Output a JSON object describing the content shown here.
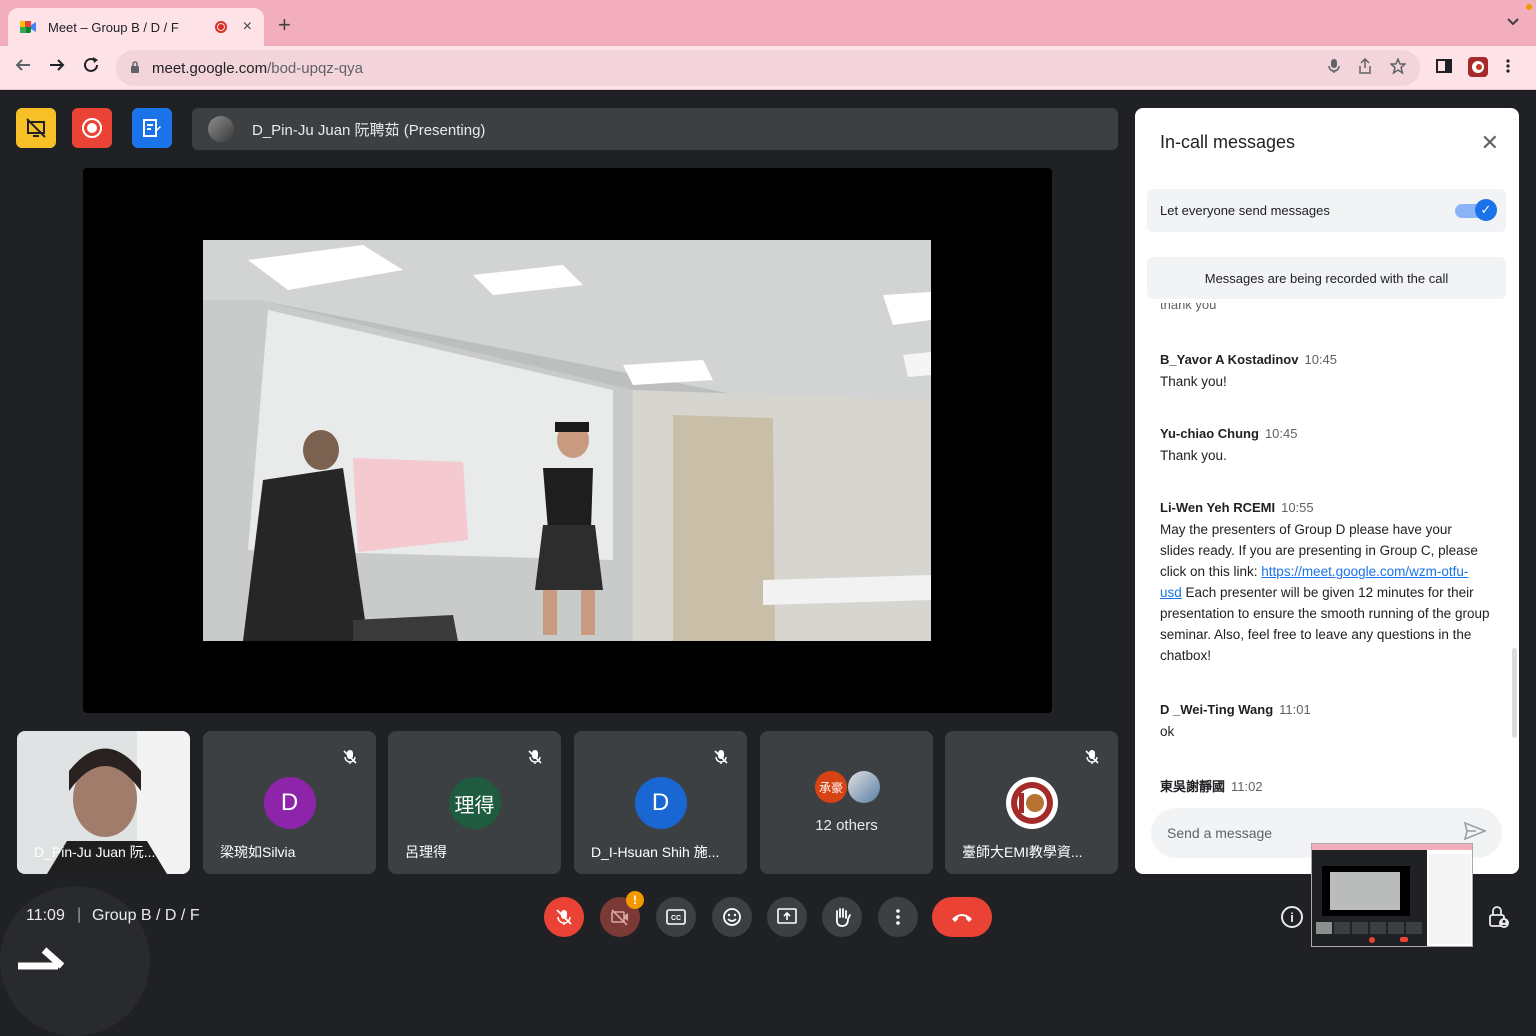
{
  "browser": {
    "tab_title": "Meet – Group B / D / F",
    "tab_close": "×",
    "new_tab": "+",
    "tab_menu": "⌄",
    "url_host": "meet.google.com",
    "url_path": "/bod-upqz-qya"
  },
  "meet": {
    "presenting_label": "D_Pin-Ju Juan 阮聘茹 (Presenting)",
    "time": "11:09",
    "separator": "|",
    "meeting_name": "Group B / D / F",
    "accent": "#1a73e8",
    "danger": "#ea4335"
  },
  "tiles": [
    {
      "name": "D_Pin-Ju Juan 阮..."
    },
    {
      "name": "梁琬如Silvia",
      "initial": "D",
      "color": "#8e24aa"
    },
    {
      "name": "呂理得",
      "initial": "理得",
      "color": "#1e5b3f"
    },
    {
      "name": "D_I-Hsuan Shih 施...",
      "initial": "D",
      "color": "#1967d2"
    },
    {
      "name": "12 others",
      "initial": "承豪"
    },
    {
      "name": "臺師大EMI教學資..."
    }
  ],
  "chat": {
    "title": "In-call messages",
    "close": "✕",
    "toggle_label": "Let everyone send messages",
    "recorded_note": "Messages are being recorded with the call",
    "faded_text": "thank you",
    "messages": [
      {
        "sender": "B_Yavor A Kostadinov",
        "time": "10:45",
        "text": "Thank you!"
      },
      {
        "sender": "Yu-chiao Chung",
        "time": "10:45",
        "text": "Thank you."
      },
      {
        "sender": "Li-Wen Yeh RCEMI",
        "time": "10:55",
        "text_before": "May the presenters of Group D please have your slides ready. If you are presenting in Group C, please click on this link: ",
        "link": "https://meet.google.com/wzm-otfu-usd",
        "text_after": "  Each presenter will be given 12 minutes for their presentation to ensure the smooth running of the group seminar. Also, feel free to leave any questions in the chatbox!"
      },
      {
        "sender": "D _Wei-Ting Wang",
        "time": "11:01",
        "text": "ok"
      },
      {
        "sender": "東吳謝靜國",
        "time": "11:02",
        "text": ""
      }
    ],
    "send_placeholder": "Send a message"
  },
  "pip_info": "i"
}
